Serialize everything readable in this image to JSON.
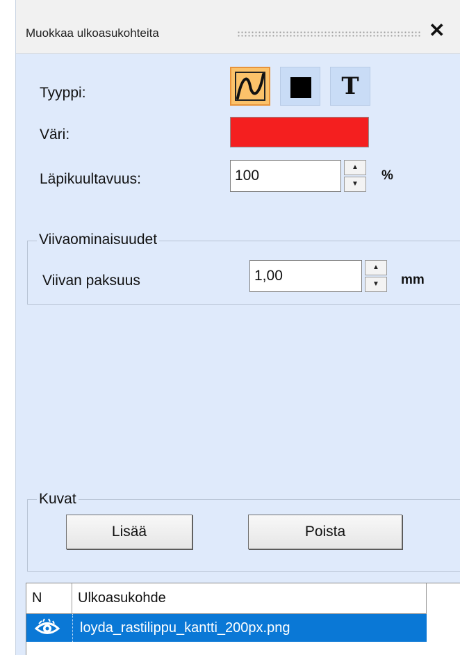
{
  "panel": {
    "title": "Muokkaa ulkoasukohteita"
  },
  "style": {
    "type_label": "Tyyppi:",
    "color_label": "Väri:",
    "color_value": "#f41f1f",
    "opacity_label": "Läpikuultavuus:",
    "opacity_value": "100",
    "opacity_unit": "%"
  },
  "line_group": {
    "title": "Viivaominaisuudet",
    "thickness_label": "Viivan paksuus",
    "thickness_value": "1,00",
    "thickness_unit": "mm"
  },
  "images_group": {
    "title": "Kuvat",
    "add_label": "Lisää",
    "remove_label": "Poista"
  },
  "list": {
    "col_n": "N",
    "col_item": "Ulkoasukohde",
    "rows": [
      {
        "name": "loyda_rastilippu_kantti_200px.png",
        "visible": true
      }
    ]
  }
}
